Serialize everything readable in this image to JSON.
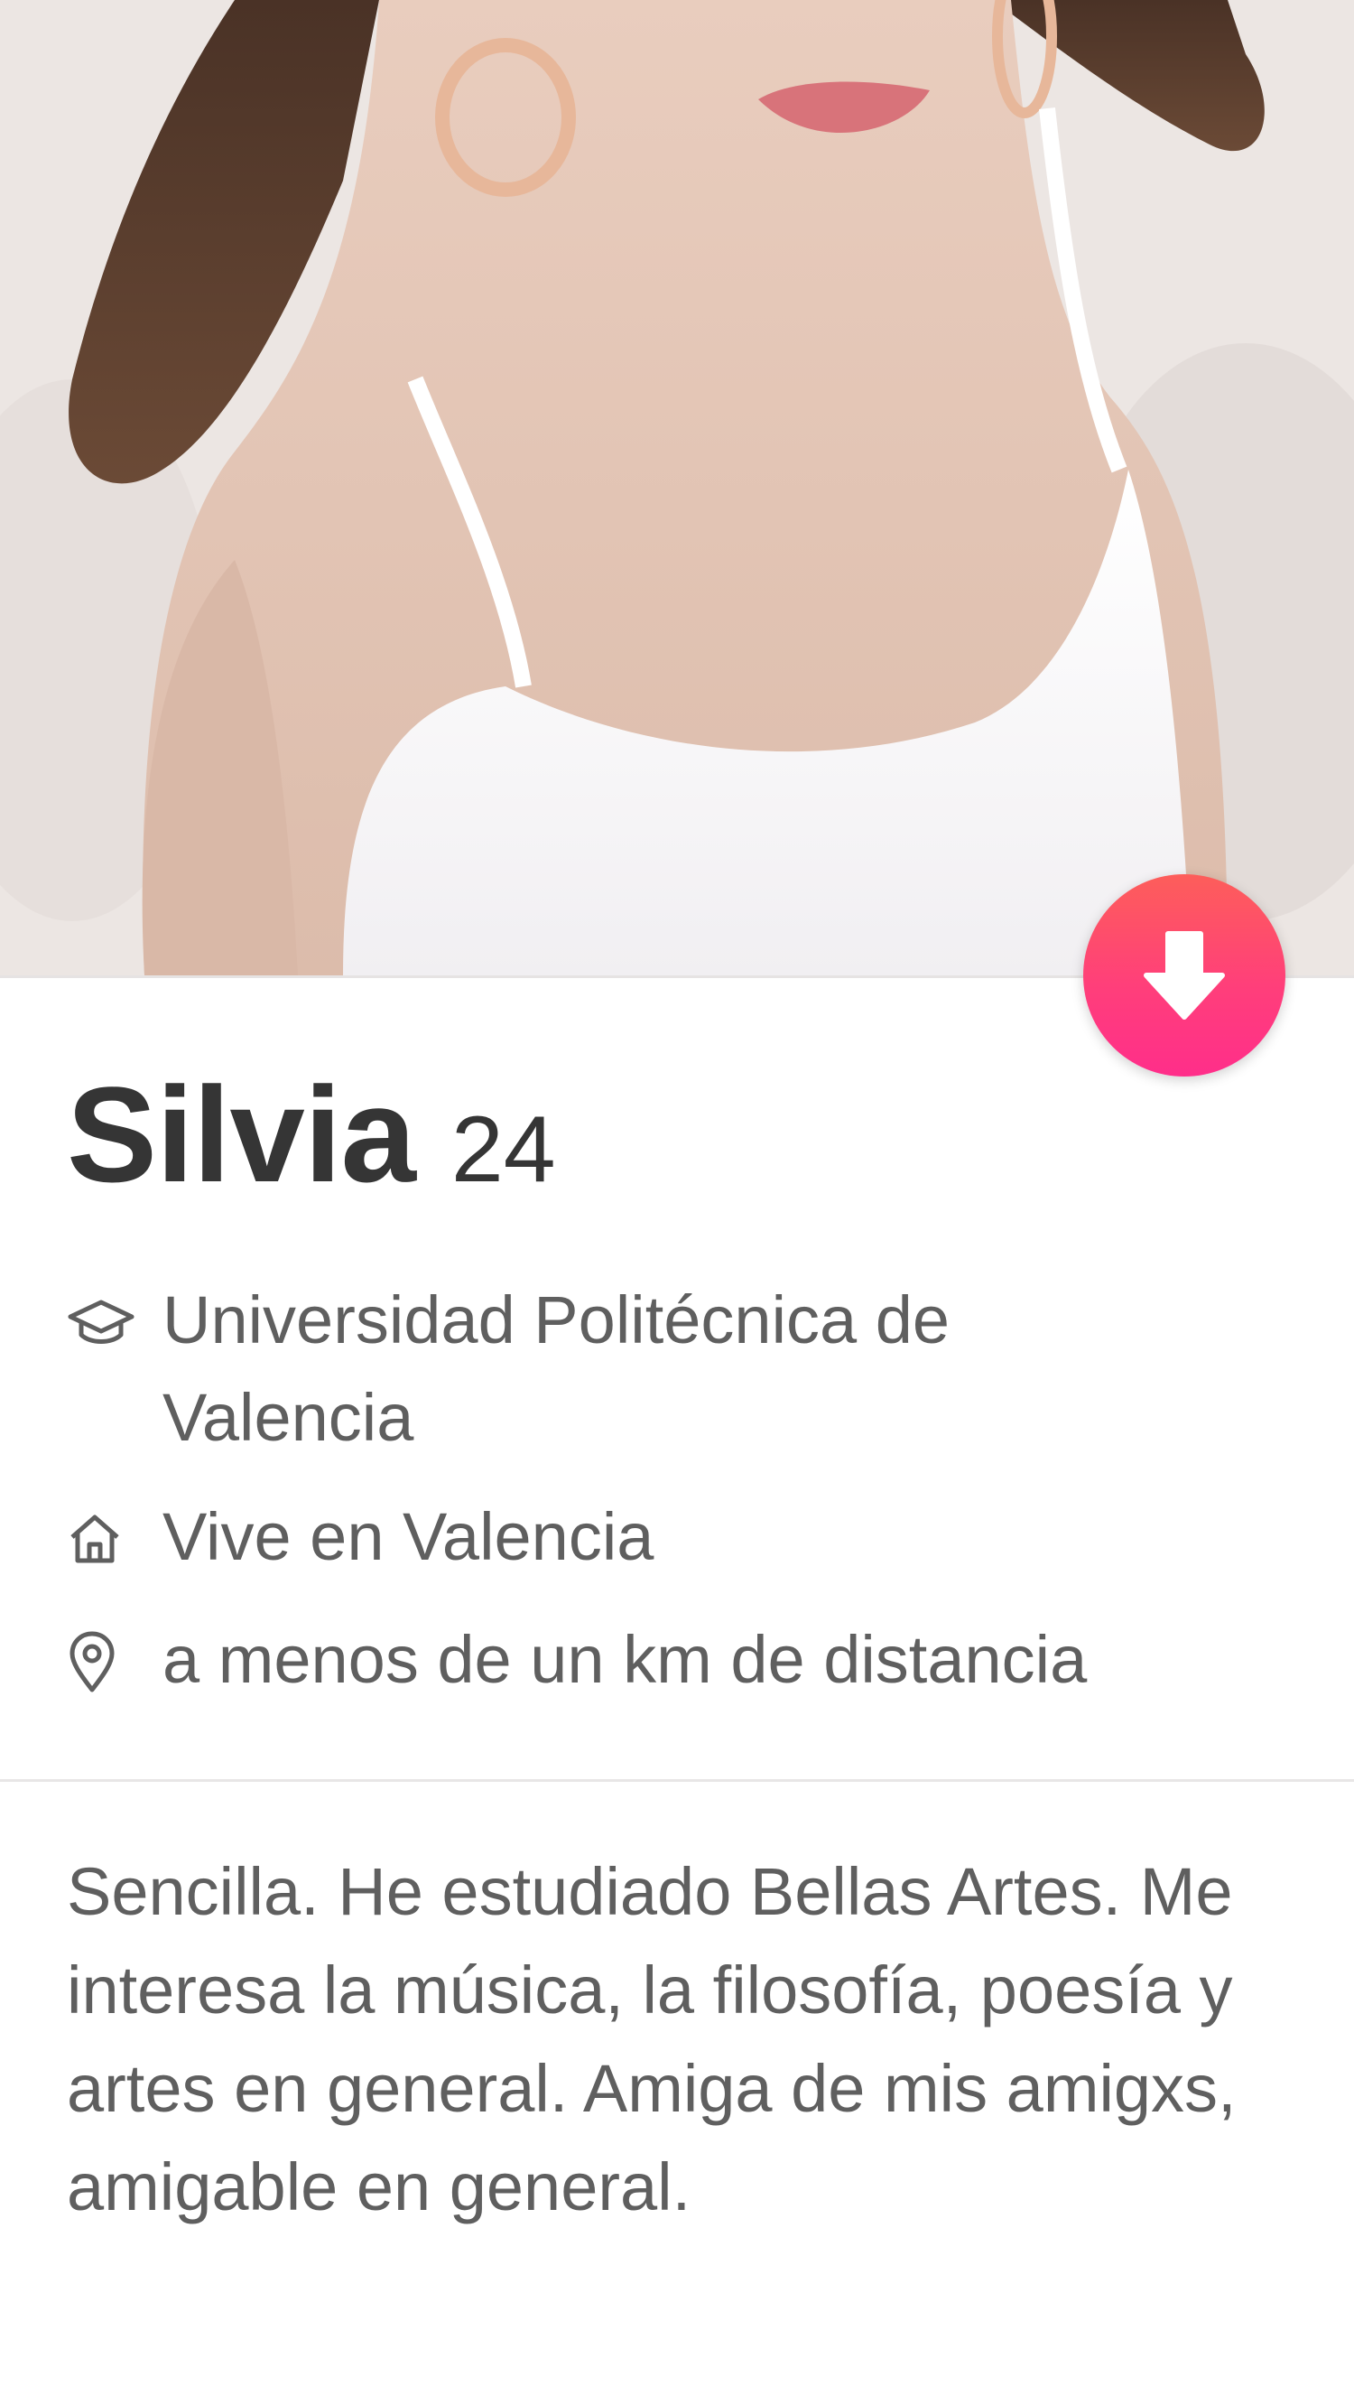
{
  "profile": {
    "name": "Silvia",
    "age": "24",
    "school": "Universidad Politécnica de Valencia",
    "home": "Vive en Valencia",
    "distance": "a menos de un km de distancia",
    "bio": "Sencilla. He estudiado Bellas Artes. Me interesa la música, la filosofía, poesía y artes en general. Amiga de mis amigxs, amigable en general."
  },
  "icons": {
    "school": "graduation-cap-icon",
    "home": "home-icon",
    "distance": "location-pin-icon",
    "collapse": "arrow-down-icon"
  },
  "colors": {
    "accent_top": "#fd5e5a",
    "accent_bottom": "#ff2e8a",
    "name_text": "#353535",
    "secondary_text": "#5f5f5f"
  }
}
